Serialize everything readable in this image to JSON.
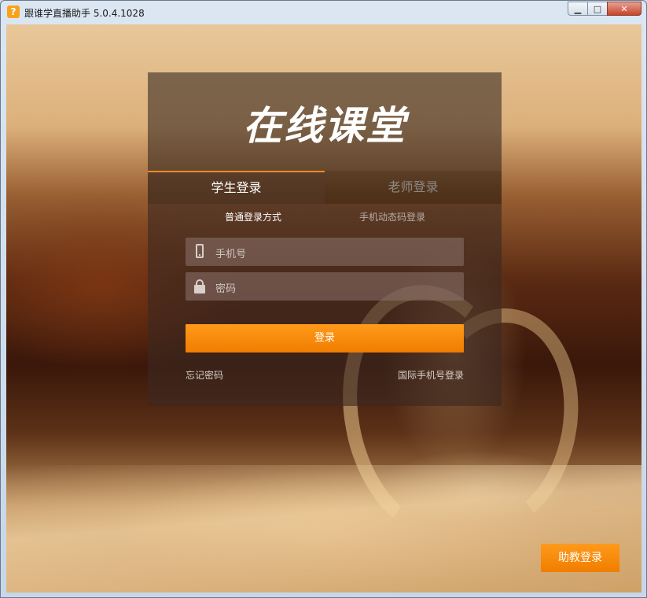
{
  "window": {
    "title": "跟谁学直播助手 5.0.4.1028",
    "app_icon": "?",
    "minimize": "▁",
    "maximize": "□",
    "close": "✕"
  },
  "panel": {
    "logo": "在线课堂",
    "tabs": {
      "student": "学生登录",
      "teacher": "老师登录"
    },
    "modes": {
      "normal": "普通登录方式",
      "sms": "手机动态码登录"
    },
    "phone_placeholder": "手机号",
    "password_placeholder": "密码",
    "login_button": "登录",
    "forgot_password": "忘记密码",
    "intl_phone_login": "国际手机号登录"
  },
  "assistant_login": "助教登录",
  "colors": {
    "accent": "#f08a24",
    "button": "#ff9a1a"
  }
}
